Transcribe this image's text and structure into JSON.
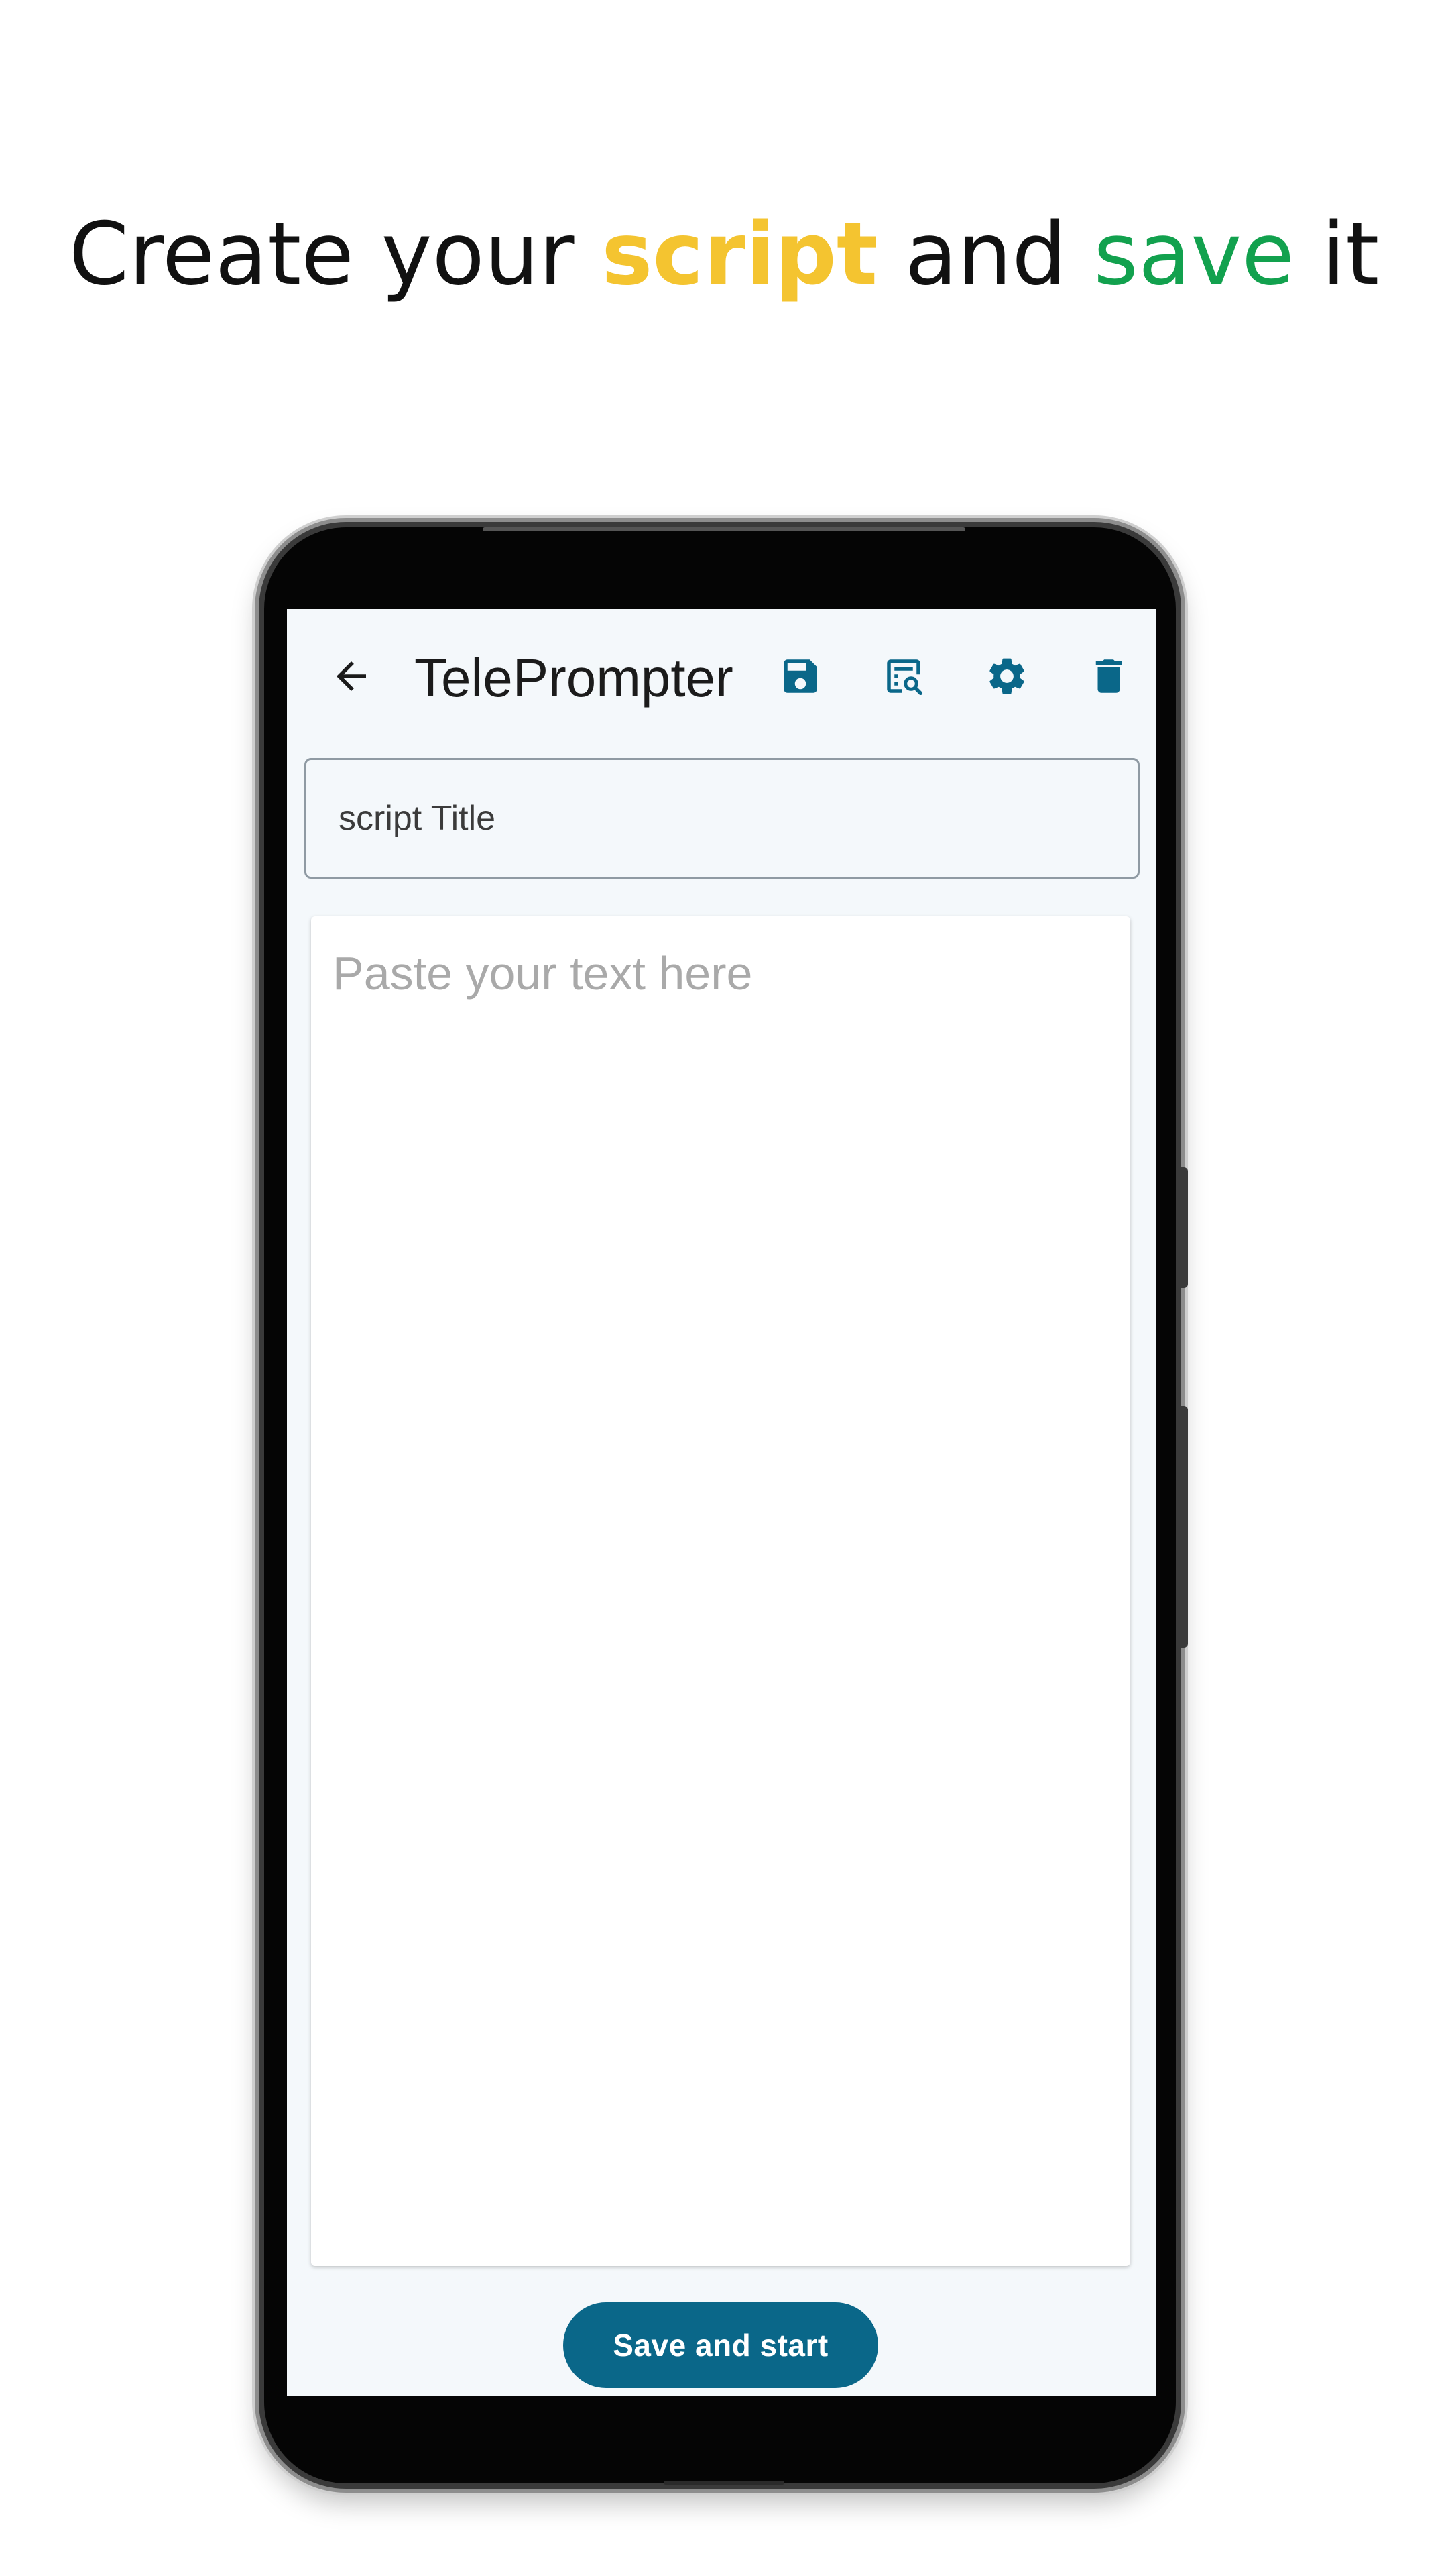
{
  "headline": {
    "part1": "Create your ",
    "word_script": "script",
    "part2": " and ",
    "word_save": "save",
    "part3": " it"
  },
  "colors": {
    "accent_yellow": "#f4c430",
    "accent_green": "#12a14e",
    "primary": "#0a6789",
    "screen_bg": "#f4f8fb"
  },
  "appbar": {
    "title": "TelePrompter",
    "icons": [
      "back-arrow-icon",
      "save-icon",
      "preview-icon",
      "settings-icon",
      "delete-icon"
    ]
  },
  "form": {
    "title_placeholder": "script Title",
    "title_value": "",
    "text_placeholder": "Paste your text here",
    "text_value": ""
  },
  "actions": {
    "save_and_start_label": "Save and start"
  }
}
